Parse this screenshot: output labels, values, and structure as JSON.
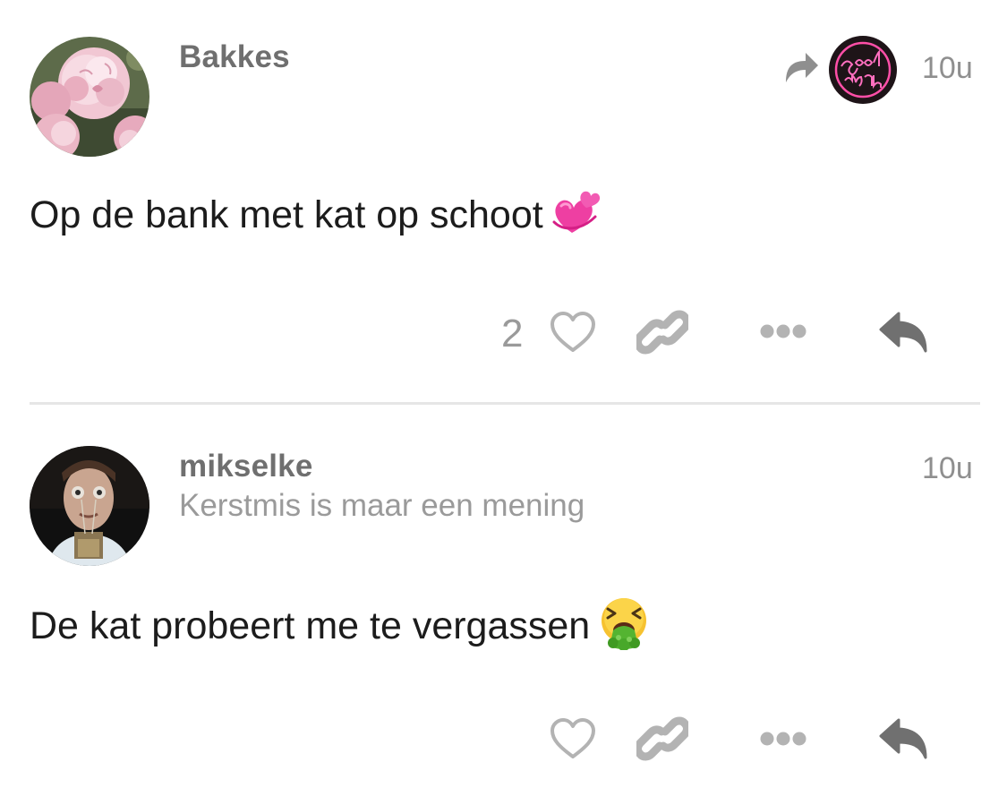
{
  "posts": [
    {
      "username": "Bakkes",
      "time": "10u",
      "text": "Op de bank met kat op schoot",
      "emoji": "revolving-hearts",
      "likes": "2",
      "boosted_by_avatar": "good-night-neon-avatar",
      "avatar": "pink-peony-avatar"
    },
    {
      "username": "mikselke",
      "subtitle": "Kerstmis is maar een mening",
      "time": "10u",
      "text": "De kat probeert me te vergassen",
      "emoji": "vomiting-face",
      "avatar": "portrait-photo-avatar"
    }
  ],
  "colors": {
    "icon_gray": "#b3b3b3",
    "reply_gray": "#707070",
    "divider": "#e6e6e6"
  }
}
